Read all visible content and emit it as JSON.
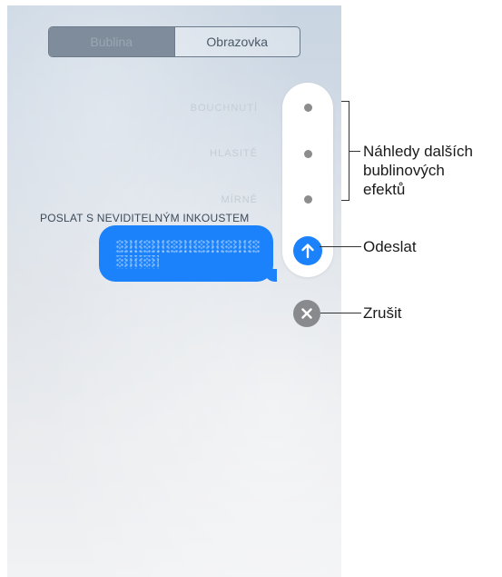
{
  "tabs": [
    "Bublina",
    "Obrazovka"
  ],
  "effects": [
    "BOUCHNUTÍ",
    "HLASITĚ",
    "MÍRNÉ"
  ],
  "invisible_ink_label": "POSLAT S NEVIDITELNÝM INKOUSTEM",
  "callouts": {
    "previews_line1": "Náhledy dalších",
    "previews_line2": "bublinových",
    "previews_line3": "efektů",
    "send": "Odeslat",
    "cancel": "Zrušit"
  },
  "colors": {
    "accent": "#1b82fb",
    "cancel": "#888a8d"
  },
  "icons": {
    "send": "arrow-up-icon",
    "cancel": "close-icon"
  }
}
